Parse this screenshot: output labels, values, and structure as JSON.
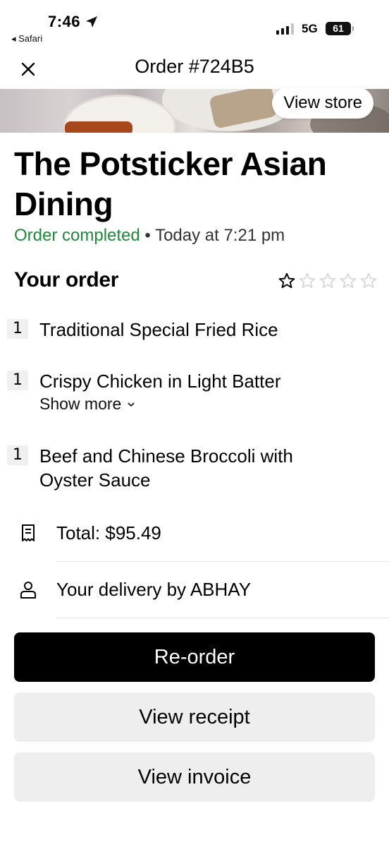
{
  "status_bar": {
    "time": "7:46",
    "back_app": "◂ Safari",
    "network": "5G",
    "battery": "61"
  },
  "header": {
    "title": "Order #724B5"
  },
  "banner": {
    "view_store_label": "View store"
  },
  "store": {
    "name": "The Potsticker Asian Dining",
    "order_status": "Order completed",
    "separator": " • ",
    "order_time": "Today at 7:21 pm"
  },
  "order": {
    "section_title": "Your order",
    "rating_stars": 5,
    "items": [
      {
        "qty": "1",
        "name": "Traditional Special Fried Rice"
      },
      {
        "qty": "1",
        "name": "Crispy Chicken in Light Batter",
        "show_more": "Show more"
      },
      {
        "qty": "1",
        "name": "Beef and Chinese Broccoli with Oyster Sauce"
      }
    ]
  },
  "summary": {
    "total": "Total: $95.49",
    "delivery": "Your delivery by ABHAY"
  },
  "actions": {
    "reorder": "Re-order",
    "view_receipt": "View receipt",
    "view_invoice": "View invoice"
  },
  "colors": {
    "status_green": "#1e8a3a",
    "primary_button": "#000000",
    "secondary_button": "#eeeeee"
  }
}
